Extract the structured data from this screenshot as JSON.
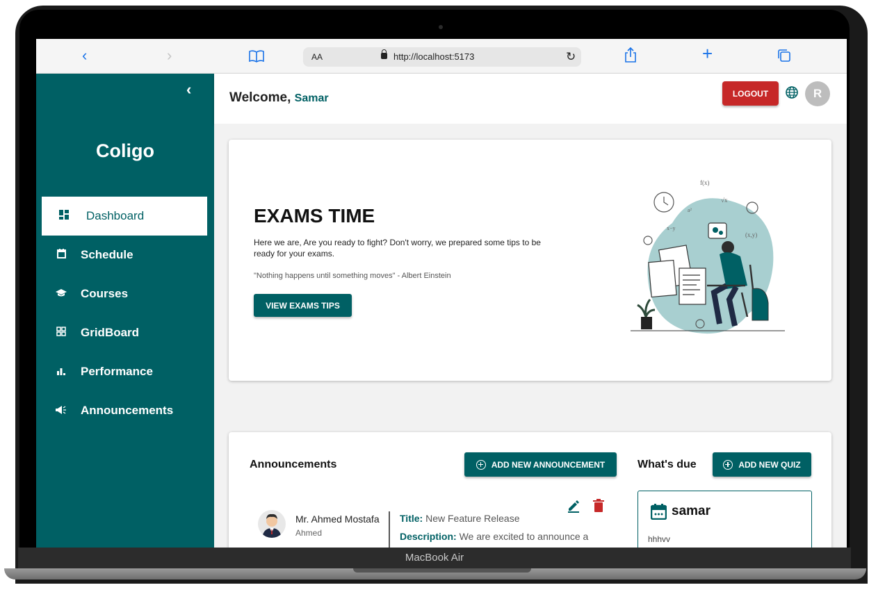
{
  "browser": {
    "text_size_label": "AA",
    "url": "http://localhost:5173"
  },
  "device": {
    "label": "MacBook Air"
  },
  "sidebar": {
    "brand": "Coligo",
    "items": [
      {
        "label": "Dashboard",
        "icon": "dashboard-icon",
        "active": true
      },
      {
        "label": "Schedule",
        "icon": "calendar-icon",
        "active": false
      },
      {
        "label": "Courses",
        "icon": "graduation-cap-icon",
        "active": false
      },
      {
        "label": "GridBoard",
        "icon": "grid-icon",
        "active": false
      },
      {
        "label": "Performance",
        "icon": "bar-chart-icon",
        "active": false
      },
      {
        "label": "Announcements",
        "icon": "megaphone-icon",
        "active": false
      }
    ]
  },
  "header": {
    "welcome": "Welcome,",
    "user_name": "Samar",
    "logout_label": "LOGOUT",
    "avatar_initial": "R"
  },
  "exams": {
    "title": "EXAMS TIME",
    "text": "Here we are, Are you ready to fight? Don't worry, we prepared some tips to be ready for your exams.",
    "quote": "\"Nothing happens until something moves\" - Albert Einstein",
    "button_label": "VIEW EXAMS TIPS"
  },
  "announcements": {
    "title": "Announcements",
    "add_button_label": "ADD NEW ANNOUNCEMENT",
    "items": [
      {
        "author": "Mr. Ahmed Mostafa",
        "username": "Ahmed",
        "title_label": "Title:",
        "title": "New Feature Release",
        "description_label": "Description:",
        "description": "We are excited to announce a new feature that will improve your"
      }
    ]
  },
  "whats_due": {
    "title": "What's due",
    "add_button_label": "ADD NEW QUIZ",
    "items": [
      {
        "name": "samar",
        "description": "hhhvv"
      }
    ]
  },
  "colors": {
    "primary": "#006064",
    "danger": "#c62828",
    "browser_accent": "#1a73e8"
  }
}
